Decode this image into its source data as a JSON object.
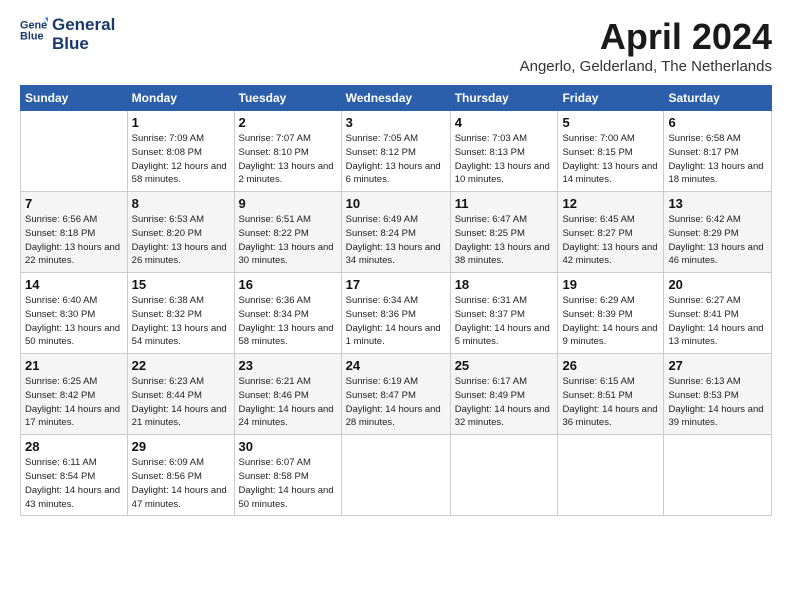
{
  "header": {
    "logo_line1": "General",
    "logo_line2": "Blue",
    "month": "April 2024",
    "location": "Angerlo, Gelderland, The Netherlands"
  },
  "days_of_week": [
    "Sunday",
    "Monday",
    "Tuesday",
    "Wednesday",
    "Thursday",
    "Friday",
    "Saturday"
  ],
  "weeks": [
    [
      {
        "day": "",
        "sunrise": "",
        "sunset": "",
        "daylight": ""
      },
      {
        "day": "1",
        "sunrise": "Sunrise: 7:09 AM",
        "sunset": "Sunset: 8:08 PM",
        "daylight": "Daylight: 12 hours and 58 minutes."
      },
      {
        "day": "2",
        "sunrise": "Sunrise: 7:07 AM",
        "sunset": "Sunset: 8:10 PM",
        "daylight": "Daylight: 13 hours and 2 minutes."
      },
      {
        "day": "3",
        "sunrise": "Sunrise: 7:05 AM",
        "sunset": "Sunset: 8:12 PM",
        "daylight": "Daylight: 13 hours and 6 minutes."
      },
      {
        "day": "4",
        "sunrise": "Sunrise: 7:03 AM",
        "sunset": "Sunset: 8:13 PM",
        "daylight": "Daylight: 13 hours and 10 minutes."
      },
      {
        "day": "5",
        "sunrise": "Sunrise: 7:00 AM",
        "sunset": "Sunset: 8:15 PM",
        "daylight": "Daylight: 13 hours and 14 minutes."
      },
      {
        "day": "6",
        "sunrise": "Sunrise: 6:58 AM",
        "sunset": "Sunset: 8:17 PM",
        "daylight": "Daylight: 13 hours and 18 minutes."
      }
    ],
    [
      {
        "day": "7",
        "sunrise": "Sunrise: 6:56 AM",
        "sunset": "Sunset: 8:18 PM",
        "daylight": "Daylight: 13 hours and 22 minutes."
      },
      {
        "day": "8",
        "sunrise": "Sunrise: 6:53 AM",
        "sunset": "Sunset: 8:20 PM",
        "daylight": "Daylight: 13 hours and 26 minutes."
      },
      {
        "day": "9",
        "sunrise": "Sunrise: 6:51 AM",
        "sunset": "Sunset: 8:22 PM",
        "daylight": "Daylight: 13 hours and 30 minutes."
      },
      {
        "day": "10",
        "sunrise": "Sunrise: 6:49 AM",
        "sunset": "Sunset: 8:24 PM",
        "daylight": "Daylight: 13 hours and 34 minutes."
      },
      {
        "day": "11",
        "sunrise": "Sunrise: 6:47 AM",
        "sunset": "Sunset: 8:25 PM",
        "daylight": "Daylight: 13 hours and 38 minutes."
      },
      {
        "day": "12",
        "sunrise": "Sunrise: 6:45 AM",
        "sunset": "Sunset: 8:27 PM",
        "daylight": "Daylight: 13 hours and 42 minutes."
      },
      {
        "day": "13",
        "sunrise": "Sunrise: 6:42 AM",
        "sunset": "Sunset: 8:29 PM",
        "daylight": "Daylight: 13 hours and 46 minutes."
      }
    ],
    [
      {
        "day": "14",
        "sunrise": "Sunrise: 6:40 AM",
        "sunset": "Sunset: 8:30 PM",
        "daylight": "Daylight: 13 hours and 50 minutes."
      },
      {
        "day": "15",
        "sunrise": "Sunrise: 6:38 AM",
        "sunset": "Sunset: 8:32 PM",
        "daylight": "Daylight: 13 hours and 54 minutes."
      },
      {
        "day": "16",
        "sunrise": "Sunrise: 6:36 AM",
        "sunset": "Sunset: 8:34 PM",
        "daylight": "Daylight: 13 hours and 58 minutes."
      },
      {
        "day": "17",
        "sunrise": "Sunrise: 6:34 AM",
        "sunset": "Sunset: 8:36 PM",
        "daylight": "Daylight: 14 hours and 1 minute."
      },
      {
        "day": "18",
        "sunrise": "Sunrise: 6:31 AM",
        "sunset": "Sunset: 8:37 PM",
        "daylight": "Daylight: 14 hours and 5 minutes."
      },
      {
        "day": "19",
        "sunrise": "Sunrise: 6:29 AM",
        "sunset": "Sunset: 8:39 PM",
        "daylight": "Daylight: 14 hours and 9 minutes."
      },
      {
        "day": "20",
        "sunrise": "Sunrise: 6:27 AM",
        "sunset": "Sunset: 8:41 PM",
        "daylight": "Daylight: 14 hours and 13 minutes."
      }
    ],
    [
      {
        "day": "21",
        "sunrise": "Sunrise: 6:25 AM",
        "sunset": "Sunset: 8:42 PM",
        "daylight": "Daylight: 14 hours and 17 minutes."
      },
      {
        "day": "22",
        "sunrise": "Sunrise: 6:23 AM",
        "sunset": "Sunset: 8:44 PM",
        "daylight": "Daylight: 14 hours and 21 minutes."
      },
      {
        "day": "23",
        "sunrise": "Sunrise: 6:21 AM",
        "sunset": "Sunset: 8:46 PM",
        "daylight": "Daylight: 14 hours and 24 minutes."
      },
      {
        "day": "24",
        "sunrise": "Sunrise: 6:19 AM",
        "sunset": "Sunset: 8:47 PM",
        "daylight": "Daylight: 14 hours and 28 minutes."
      },
      {
        "day": "25",
        "sunrise": "Sunrise: 6:17 AM",
        "sunset": "Sunset: 8:49 PM",
        "daylight": "Daylight: 14 hours and 32 minutes."
      },
      {
        "day": "26",
        "sunrise": "Sunrise: 6:15 AM",
        "sunset": "Sunset: 8:51 PM",
        "daylight": "Daylight: 14 hours and 36 minutes."
      },
      {
        "day": "27",
        "sunrise": "Sunrise: 6:13 AM",
        "sunset": "Sunset: 8:53 PM",
        "daylight": "Daylight: 14 hours and 39 minutes."
      }
    ],
    [
      {
        "day": "28",
        "sunrise": "Sunrise: 6:11 AM",
        "sunset": "Sunset: 8:54 PM",
        "daylight": "Daylight: 14 hours and 43 minutes."
      },
      {
        "day": "29",
        "sunrise": "Sunrise: 6:09 AM",
        "sunset": "Sunset: 8:56 PM",
        "daylight": "Daylight: 14 hours and 47 minutes."
      },
      {
        "day": "30",
        "sunrise": "Sunrise: 6:07 AM",
        "sunset": "Sunset: 8:58 PM",
        "daylight": "Daylight: 14 hours and 50 minutes."
      },
      {
        "day": "",
        "sunrise": "",
        "sunset": "",
        "daylight": ""
      },
      {
        "day": "",
        "sunrise": "",
        "sunset": "",
        "daylight": ""
      },
      {
        "day": "",
        "sunrise": "",
        "sunset": "",
        "daylight": ""
      },
      {
        "day": "",
        "sunrise": "",
        "sunset": "",
        "daylight": ""
      }
    ]
  ]
}
